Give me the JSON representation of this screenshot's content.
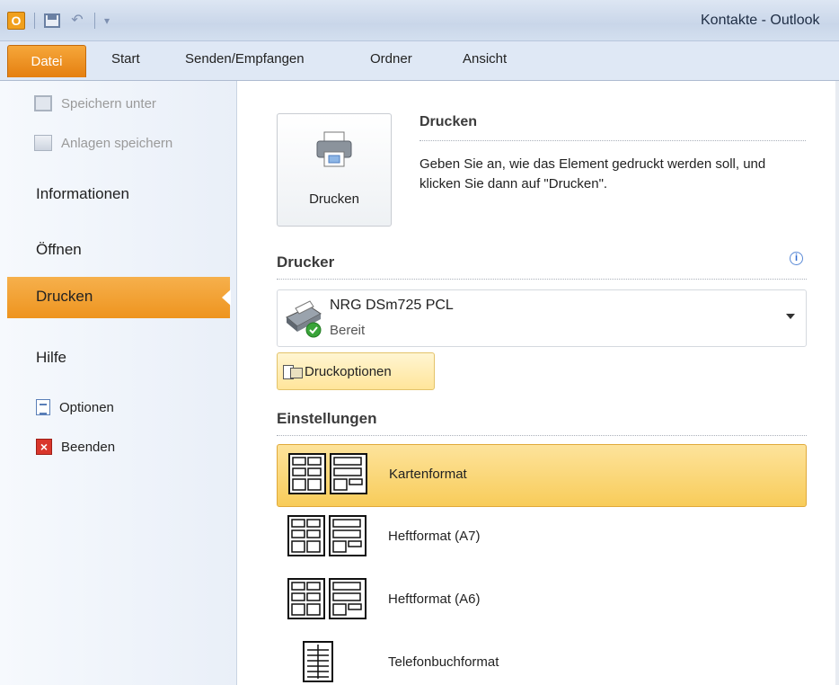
{
  "window": {
    "title": "Kontakte - Outlook"
  },
  "ribbon": {
    "tabs": [
      "Datei",
      "Start",
      "Senden/Empfangen",
      "Ordner",
      "Ansicht"
    ]
  },
  "nav": {
    "save_as": "Speichern unter",
    "save_attachments": "Anlagen speichern",
    "info": "Informationen",
    "open": "Öffnen",
    "print": "Drucken",
    "help": "Hilfe",
    "options": "Optionen",
    "exit": "Beenden"
  },
  "print": {
    "button_label": "Drucken",
    "heading": "Drucken",
    "description": "Geben Sie an, wie das Element gedruckt werden soll, und klicken Sie dann auf \"Drucken\"."
  },
  "printer": {
    "section": "Drucker",
    "name": "NRG DSm725 PCL",
    "status": "Bereit",
    "options_button": "Druckoptionen"
  },
  "settings": {
    "section": "Einstellungen",
    "formats": [
      {
        "label": "Kartenformat",
        "selected": true
      },
      {
        "label": "Heftformat (A7)",
        "selected": false
      },
      {
        "label": "Heftformat (A6)",
        "selected": false
      },
      {
        "label": "Telefonbuchformat",
        "selected": false
      }
    ]
  },
  "colors": {
    "accent": "#ee941f",
    "selected": "#f8cc5a"
  },
  "icons": [
    "outlook-logo-icon",
    "save-icon",
    "undo-icon",
    "printer-icon",
    "info-icon",
    "options-icon",
    "exit-icon"
  ]
}
